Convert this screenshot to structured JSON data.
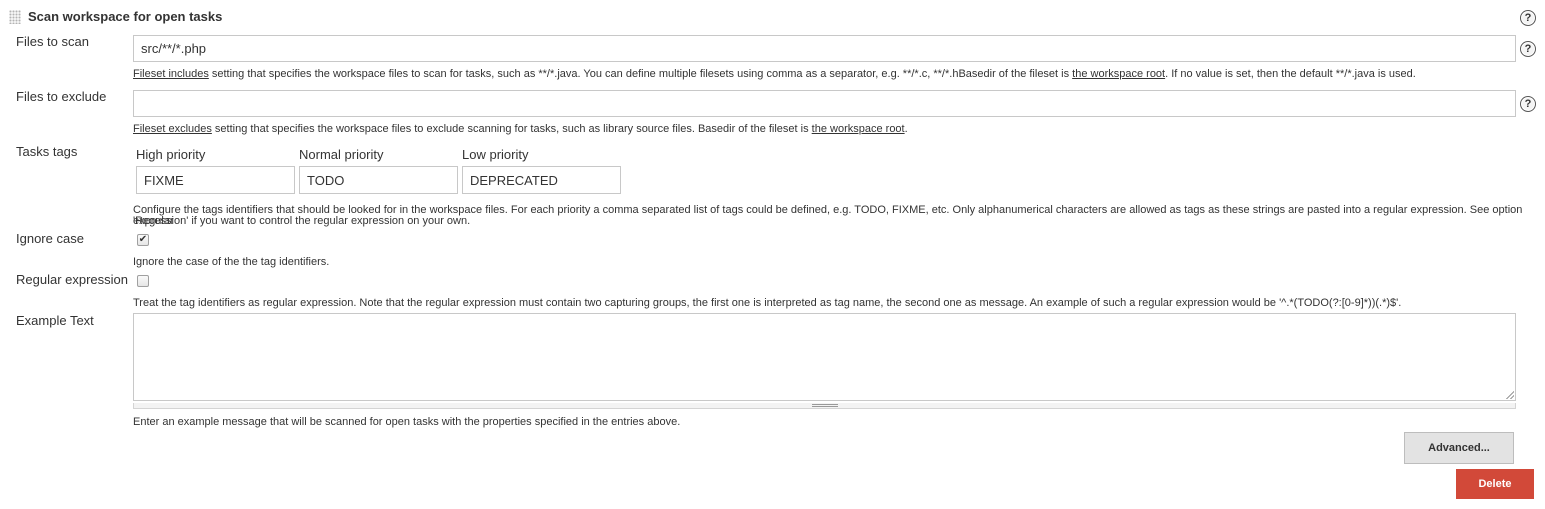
{
  "section": {
    "title": "Scan workspace for open tasks",
    "help_icon": "question-circle-icon"
  },
  "files_to_scan": {
    "label": "Files to scan",
    "value": "src/**/*.php",
    "help_icon": "question-circle-icon",
    "desc_link1": "Fileset includes",
    "desc_text1": " setting that specifies the workspace files to scan for tasks, such as **/*.java. You can define multiple filesets using comma as a separator, e.g. **/*.c, **/*.hBasedir of the fileset is ",
    "desc_link2": "the workspace root",
    "desc_text2": ". If no value is set, then the default **/*.java is used."
  },
  "files_to_exclude": {
    "label": "Files to exclude",
    "value": "",
    "help_icon": "question-circle-icon",
    "desc_link1": "Fileset excludes",
    "desc_text1": " setting that specifies the workspace files to exclude scanning for tasks, such as library source files. Basedir of the fileset is ",
    "desc_link2": "the workspace root",
    "desc_text2": "."
  },
  "tasks_tags": {
    "label": "Tasks tags",
    "high_label": "High priority",
    "high_value": "FIXME",
    "normal_label": "Normal priority",
    "normal_value": "TODO",
    "low_label": "Low priority",
    "low_value": "DEPRECATED",
    "desc_line1": "Configure the tags identifiers that should be looked for in the workspace files. For each priority a comma separated list of tags could be defined, e.g. TODO, FIXME, etc. Only alphanumerical characters are allowed as tags as these strings are pasted into a regular expression. See option 'Regular",
    "desc_line2": "expression' if you want to control the regular expression on your own."
  },
  "ignore_case": {
    "label": "Ignore case",
    "checked": true,
    "check_glyph": "✔",
    "desc": "Ignore the case of the the tag identifiers."
  },
  "regular_expression": {
    "label": "Regular expression",
    "checked": false,
    "desc": "Treat the tag identifiers as regular expression. Note that the regular expression must contain two capturing groups, the first one is interpreted as tag name, the second one as message. An example of such a regular expression would be '^.*(TODO(?:[0-9]*))(.*)$'."
  },
  "example_text": {
    "label": "Example Text",
    "value": "",
    "desc": "Enter an example message that will be scanned for open tasks with the properties specified in the entries above."
  },
  "buttons": {
    "advanced": "Advanced...",
    "delete": "Delete"
  },
  "colors": {
    "delete_button": "#d24939",
    "advanced_button": "#e3e3e3",
    "text": "#333333",
    "border": "#c8c8c8"
  }
}
